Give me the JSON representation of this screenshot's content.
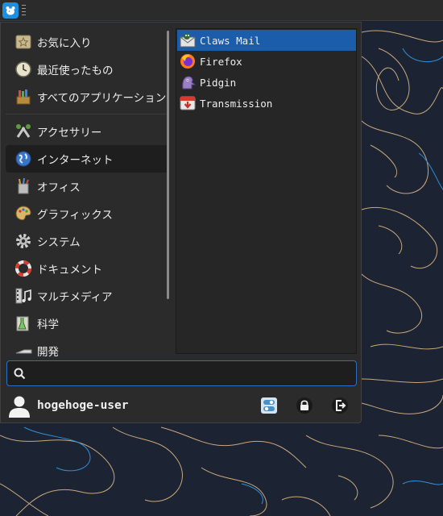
{
  "taskbar": {
    "menu_button_icon": "xfce-mouse-icon"
  },
  "menu": {
    "categories": [
      {
        "label": "お気に入り",
        "icon": "favorites-icon",
        "selected": false
      },
      {
        "label": "最近使ったもの",
        "icon": "recent-clock-icon",
        "selected": false
      },
      {
        "label": "すべてのアプリケーション",
        "icon": "all-applications-icon",
        "selected": false
      },
      {
        "label": "アクセサリー",
        "icon": "accessories-icon",
        "selected": false
      },
      {
        "label": "インターネット",
        "icon": "internet-globe-icon",
        "selected": true
      },
      {
        "label": "オフィス",
        "icon": "office-icon",
        "selected": false
      },
      {
        "label": "グラフィックス",
        "icon": "graphics-palette-icon",
        "selected": false
      },
      {
        "label": "システム",
        "icon": "system-gear-icon",
        "selected": false
      },
      {
        "label": "ドキュメント",
        "icon": "documentation-lifebuoy-icon",
        "selected": false
      },
      {
        "label": "マルチメディア",
        "icon": "multimedia-icon",
        "selected": false
      },
      {
        "label": "科学",
        "icon": "science-icon",
        "selected": false
      },
      {
        "label": "開発",
        "icon": "development-icon",
        "selected": false
      }
    ],
    "apps": [
      {
        "label": "Claws Mail",
        "icon": "claws-mail-icon",
        "selected": true
      },
      {
        "label": "Firefox",
        "icon": "firefox-icon",
        "selected": false
      },
      {
        "label": "Pidgin",
        "icon": "pidgin-icon",
        "selected": false
      },
      {
        "label": "Transmission",
        "icon": "transmission-icon",
        "selected": false
      }
    ],
    "search": {
      "value": "",
      "placeholder": "",
      "icon": "search-icon"
    },
    "user": {
      "name": "hogehoge-user",
      "icon": "user-avatar-icon"
    },
    "actions": [
      {
        "icon": "settings-toggle-icon"
      },
      {
        "icon": "lock-icon"
      },
      {
        "icon": "logout-icon"
      }
    ],
    "colors": {
      "selection": "#1b5cab",
      "search_border": "#2c6fc0",
      "background": "#2b2b2b",
      "wallpaper": "#1c2433"
    }
  }
}
